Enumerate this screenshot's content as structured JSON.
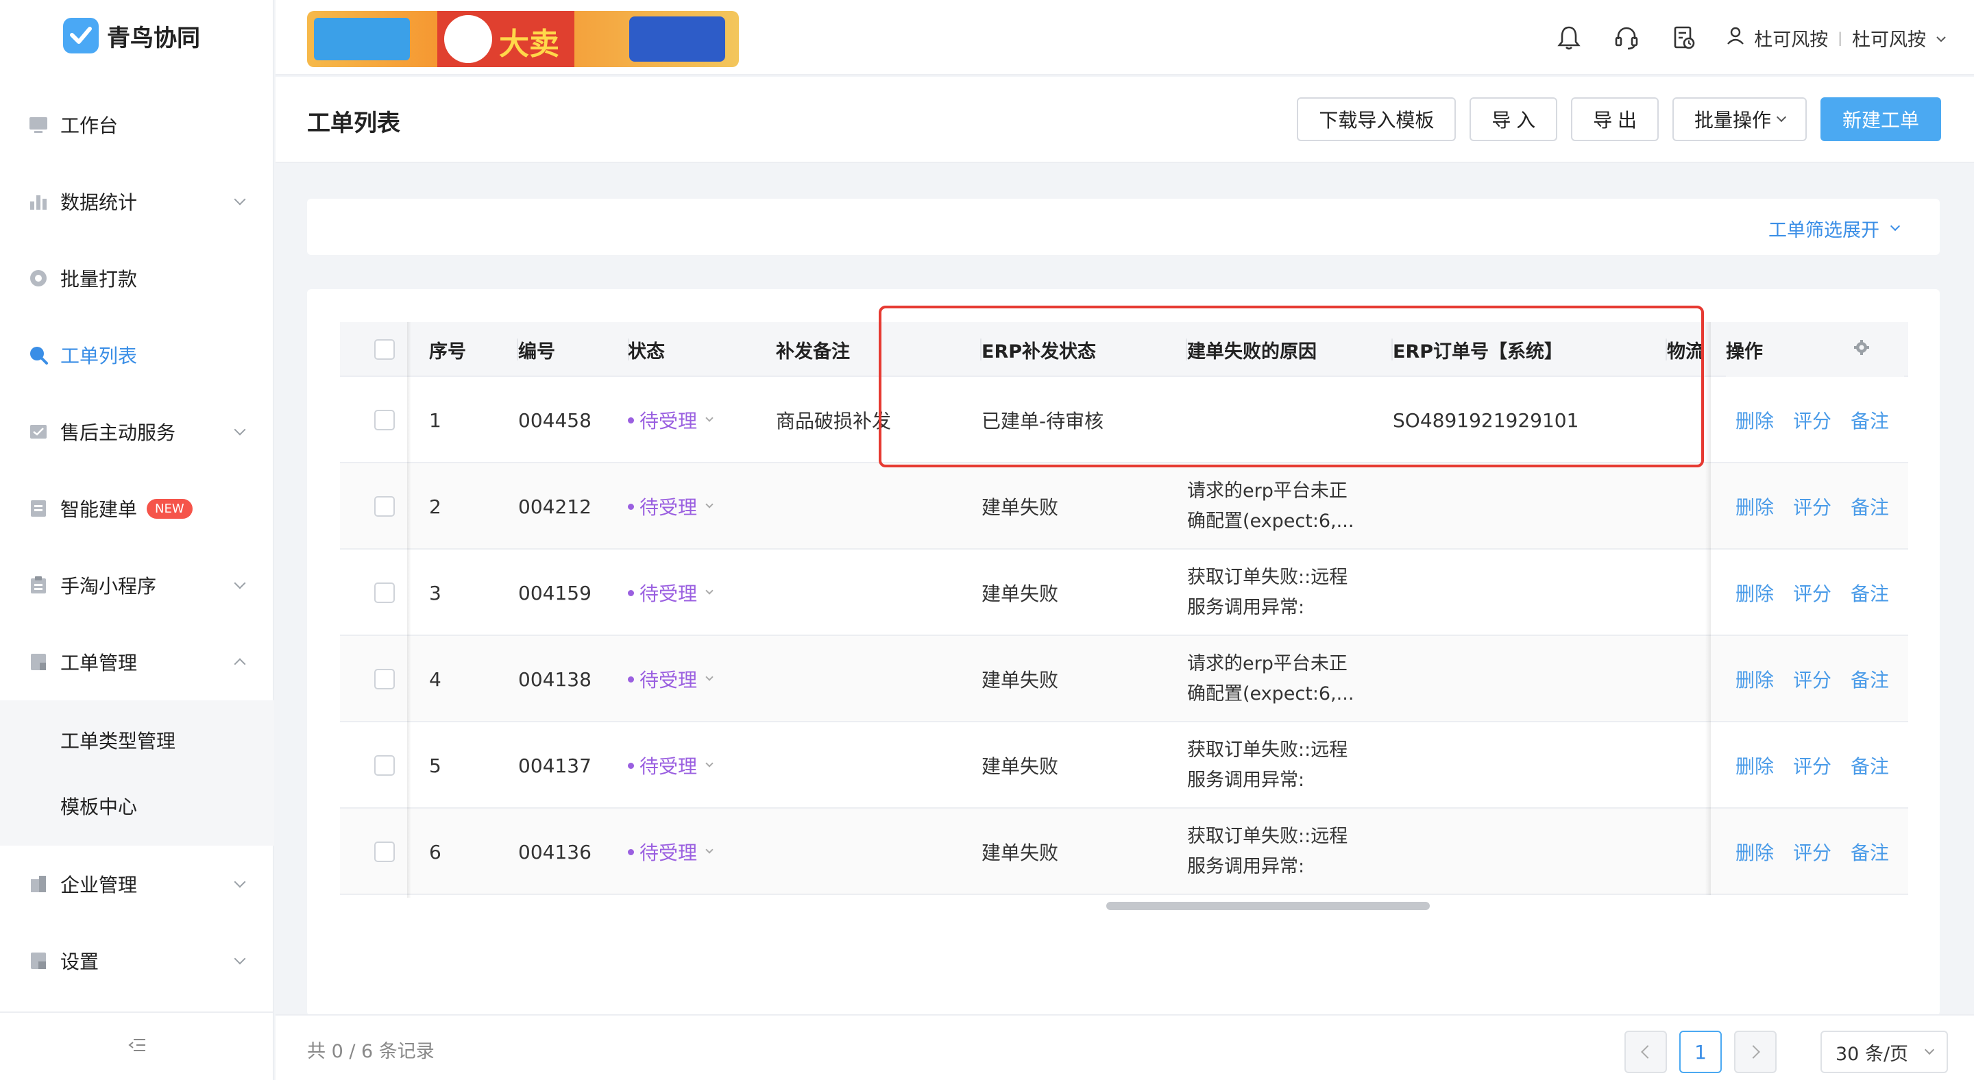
{
  "app": {
    "name": "青鸟协同"
  },
  "sidebar": {
    "items": [
      {
        "label": "工作台",
        "icon": "monitor-icon"
      },
      {
        "label": "数据统计",
        "icon": "bar-chart-icon"
      },
      {
        "label": "批量打款",
        "icon": "circle-icon"
      },
      {
        "label": "工单列表",
        "icon": "search-icon"
      },
      {
        "label": "售后主动服务",
        "icon": "service-icon"
      },
      {
        "label": "智能建单",
        "icon": "doc-icon",
        "badge": "NEW"
      },
      {
        "label": "手淘小程序",
        "icon": "clipboard-icon"
      },
      {
        "label": "工单管理",
        "icon": "form-icon"
      },
      {
        "label": "企业管理",
        "icon": "building-icon"
      },
      {
        "label": "设置",
        "icon": "settings-icon"
      }
    ],
    "submenu": [
      "工单类型管理",
      "模板中心"
    ]
  },
  "topbar": {
    "banner_text": "大卖",
    "user": {
      "shop": "杜可风按",
      "name": "杜可风按"
    }
  },
  "page": {
    "title": "工单列表",
    "actions": {
      "download": "下载导入模板",
      "import": "导 入",
      "export": "导 出",
      "batch": "批量操作",
      "create": "新建工单"
    },
    "filter_toggle": "工单筛选展开"
  },
  "table": {
    "headers": {
      "seq": "序号",
      "id": "编号",
      "status": "状态",
      "remark": "补发备注",
      "erp_status": "ERP补发状态",
      "fail_reason": "建单失败的原因",
      "erp_order": "ERP订单号【系统】",
      "logistics": "物流",
      "ops": "操作"
    },
    "op_labels": {
      "delete": "删除",
      "rate": "评分",
      "note": "备注"
    },
    "rows": [
      {
        "seq": "1",
        "id": "004458",
        "status": "待受理",
        "remark": "商品破损补发",
        "erp_status": "已建单-待审核",
        "fail_reason": "",
        "erp_order": "SO4891921929101"
      },
      {
        "seq": "2",
        "id": "004212",
        "status": "待受理",
        "remark": "",
        "erp_status": "建单失败",
        "fail_reason": "请求的erp平台未正\n确配置(expect:6,...",
        "erp_order": ""
      },
      {
        "seq": "3",
        "id": "004159",
        "status": "待受理",
        "remark": "",
        "erp_status": "建单失败",
        "fail_reason": "获取订单失败::远程\n服务调用异常:",
        "erp_order": ""
      },
      {
        "seq": "4",
        "id": "004138",
        "status": "待受理",
        "remark": "",
        "erp_status": "建单失败",
        "fail_reason": "请求的erp平台未正\n确配置(expect:6,...",
        "erp_order": ""
      },
      {
        "seq": "5",
        "id": "004137",
        "status": "待受理",
        "remark": "",
        "erp_status": "建单失败",
        "fail_reason": "获取订单失败::远程\n服务调用异常:",
        "erp_order": ""
      },
      {
        "seq": "6",
        "id": "004136",
        "status": "待受理",
        "remark": "",
        "erp_status": "建单失败",
        "fail_reason": "获取订单失败::远程\n服务调用异常:",
        "erp_order": ""
      }
    ]
  },
  "footer": {
    "count": "共 0 / 6 条记录",
    "page": "1",
    "page_size": "30 条/页"
  },
  "colors": {
    "accent": "#4ba9f2",
    "status": "#9a5fe0",
    "highlight": "#e63a32"
  }
}
